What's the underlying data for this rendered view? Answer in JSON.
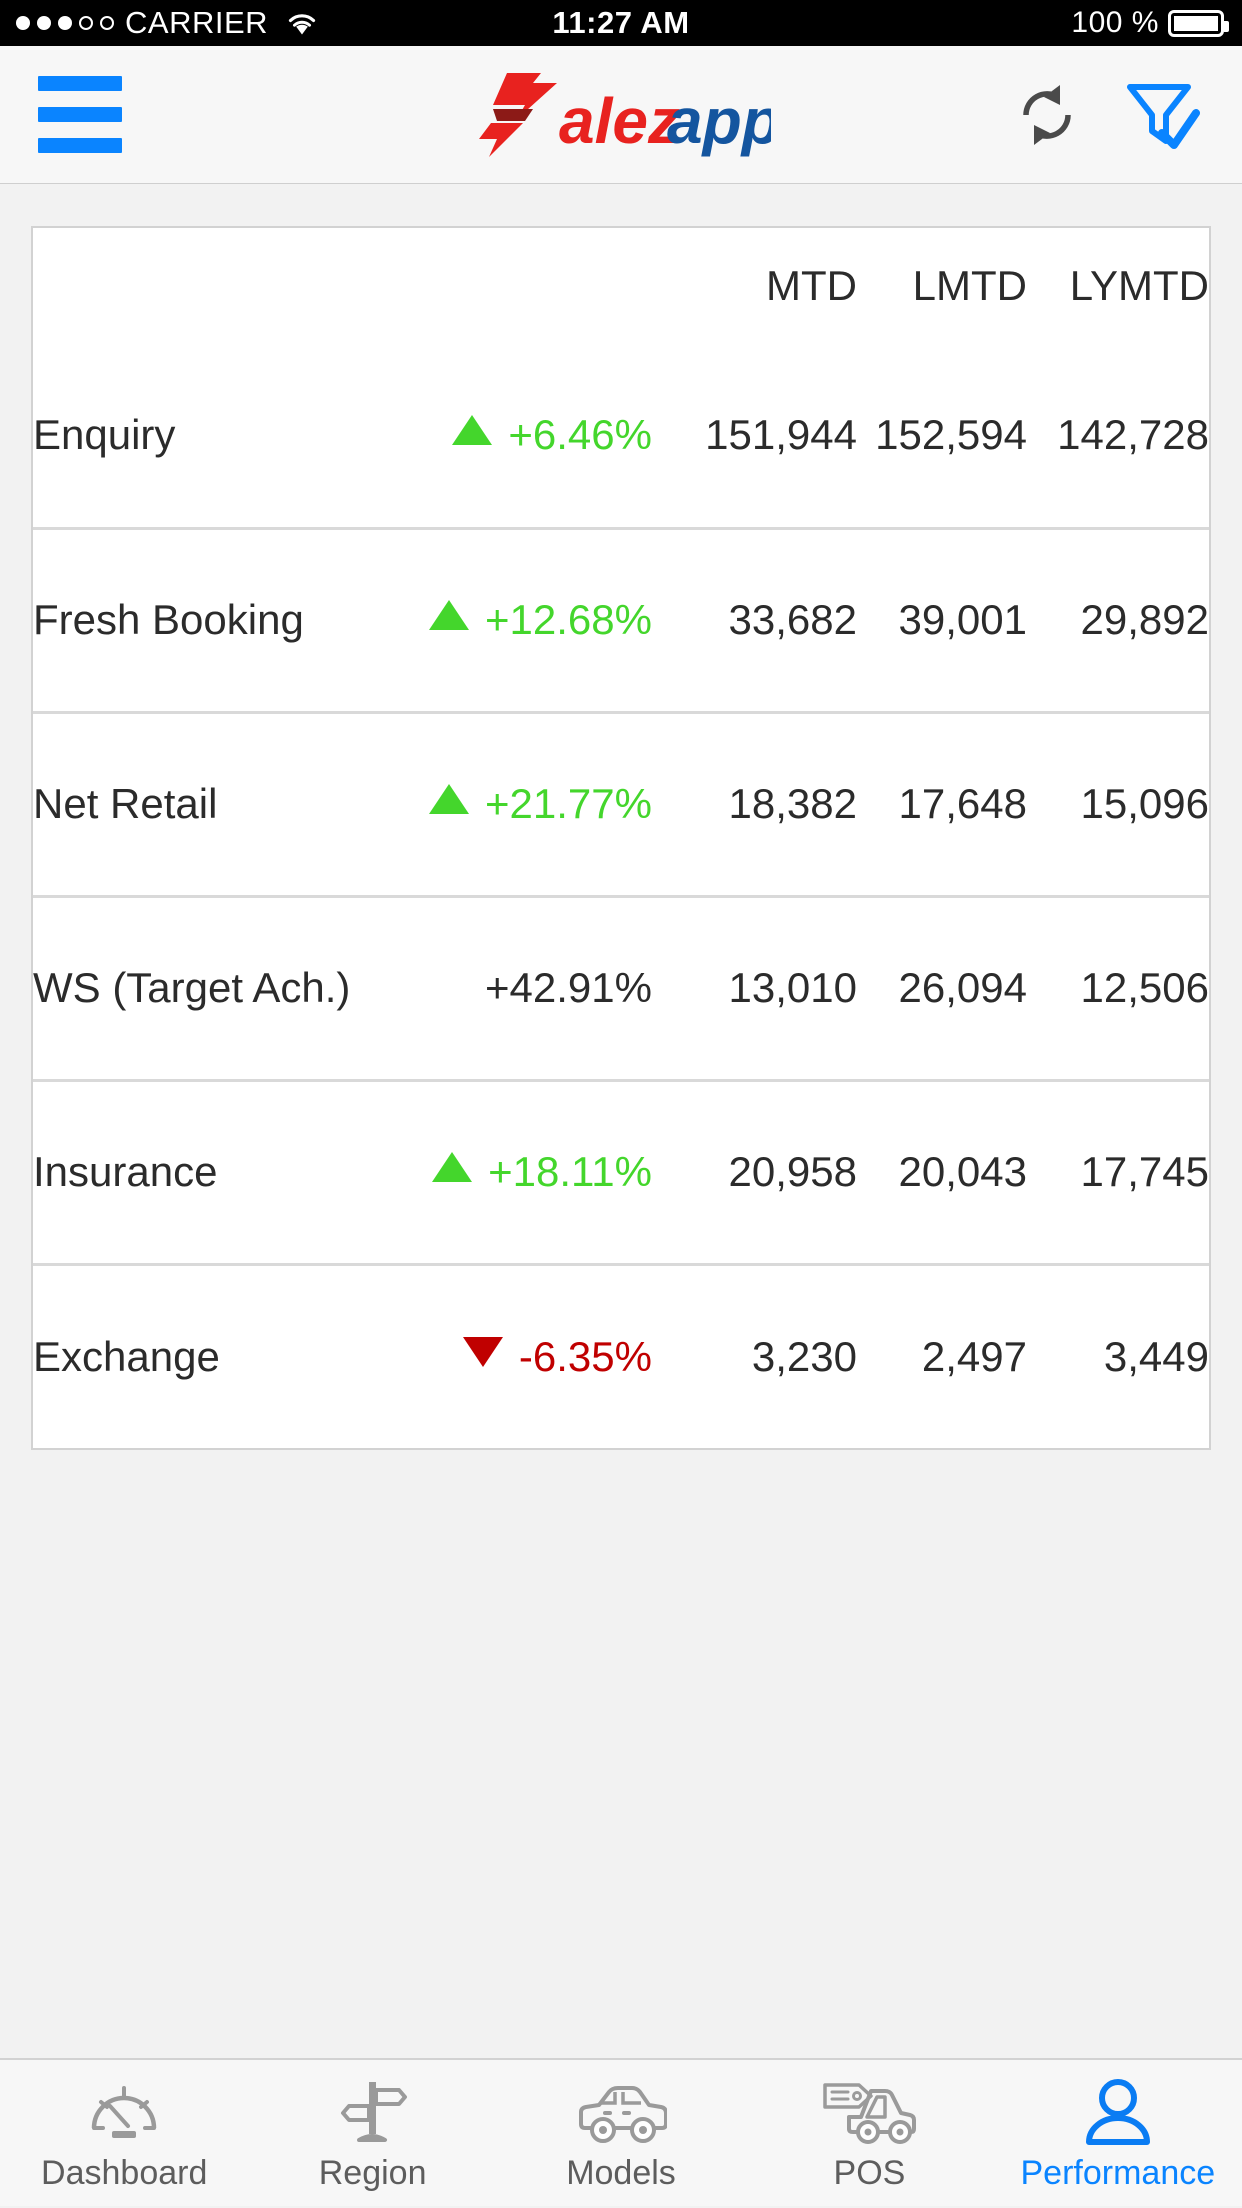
{
  "status_bar": {
    "signal_filled": 3,
    "signal_empty": 2,
    "carrier": "CARRIER",
    "wifi_icon": "wifi-icon",
    "time": "11:27 AM",
    "battery_percent": "100 %",
    "battery_icon": "battery-full-icon"
  },
  "header": {
    "menu_icon": "hamburger-menu-icon",
    "logo_text_primary": "alez",
    "logo_text_secondary": "app",
    "logo_alt": "Salezapp",
    "refresh_icon": "refresh-sync-icon",
    "filter_icon": "filter-check-icon",
    "colors": {
      "logo_red": "#e8221f",
      "logo_dark_red": "#8c1a17",
      "logo_blue": "#14559f",
      "accent_blue": "#0a84ff"
    }
  },
  "table": {
    "columns": [
      "",
      "",
      "MTD",
      "LMTD",
      "LYMTD"
    ],
    "rows": [
      {
        "label": "Enquiry",
        "trend": "up",
        "delta": "+6.46%",
        "mtd": "151,944",
        "lmtd": "152,594",
        "lymtd": "142,728"
      },
      {
        "label": "Fresh Booking",
        "trend": "up",
        "delta": "+12.68%",
        "mtd": "33,682",
        "lmtd": "39,001",
        "lymtd": "29,892"
      },
      {
        "label": "Net Retail",
        "trend": "up",
        "delta": "+21.77%",
        "mtd": "18,382",
        "lmtd": "17,648",
        "lymtd": "15,096"
      },
      {
        "label": "WS (Target Ach.)",
        "trend": "none",
        "delta": "+42.91%",
        "mtd": "13,010",
        "lmtd": "26,094",
        "lymtd": "12,506"
      },
      {
        "label": "Insurance",
        "trend": "up",
        "delta": "+18.11%",
        "mtd": "20,958",
        "lmtd": "20,043",
        "lymtd": "17,745"
      },
      {
        "label": "Exchange",
        "trend": "down",
        "delta": "-6.35%",
        "mtd": "3,230",
        "lmtd": "2,497",
        "lymtd": "3,449"
      }
    ],
    "colors": {
      "up": "#44d62c",
      "down": "#c00000",
      "neutral": "#2b2b2b"
    }
  },
  "tabbar": {
    "items": [
      {
        "label": "Dashboard",
        "icon": "speedometer-icon",
        "active": false
      },
      {
        "label": "Region",
        "icon": "signpost-icon",
        "active": false
      },
      {
        "label": "Models",
        "icon": "car-icon",
        "active": false
      },
      {
        "label": "POS",
        "icon": "tag-truck-icon",
        "active": false
      },
      {
        "label": "Performance",
        "icon": "person-icon",
        "active": true
      }
    ],
    "active_color": "#0a84ff",
    "inactive_color": "#8c8c8c"
  }
}
